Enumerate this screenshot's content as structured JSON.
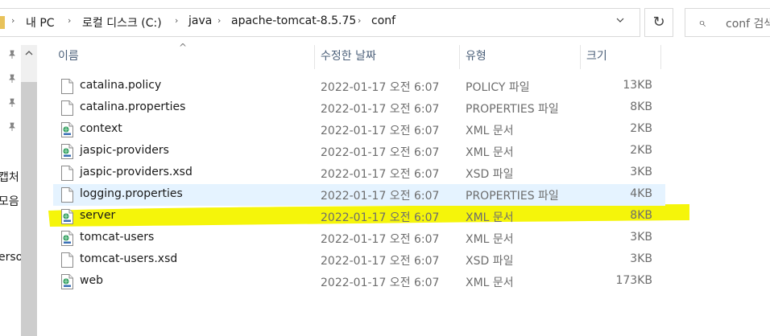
{
  "address_bar": {
    "breadcrumbs": [
      "내 PC",
      "로컬 디스크 (C:)",
      "java",
      "apache-tomcat-8.5.75",
      "conf"
    ],
    "separator": "›",
    "dropdown_icon": "chevron-down-icon",
    "refresh_icon": "refresh-icon",
    "refresh_glyph": "↻"
  },
  "search": {
    "placeholder": "conf 검색",
    "icon": "search-icon",
    "glyph": "⌕"
  },
  "nav_pane": {
    "pin_icons": 4,
    "labels": [
      "캡처",
      "모음",
      "erso"
    ]
  },
  "columns": {
    "name": "이름",
    "date": "수정한 날짜",
    "type": "유형",
    "size": "크기",
    "sort_glyph": "^"
  },
  "files": [
    {
      "name": "catalina.policy",
      "date": "2022-01-17 오전 6:07",
      "type": "POLICY 파일",
      "size": "13KB",
      "icon": "generic-file-icon"
    },
    {
      "name": "catalina.properties",
      "date": "2022-01-17 오전 6:07",
      "type": "PROPERTIES 파일",
      "size": "8KB",
      "icon": "generic-file-icon"
    },
    {
      "name": "context",
      "date": "2022-01-17 오전 6:07",
      "type": "XML 문서",
      "size": "2KB",
      "icon": "xml-file-icon"
    },
    {
      "name": "jaspic-providers",
      "date": "2022-01-17 오전 6:07",
      "type": "XML 문서",
      "size": "2KB",
      "icon": "xml-file-icon"
    },
    {
      "name": "jaspic-providers.xsd",
      "date": "2022-01-17 오전 6:07",
      "type": "XSD 파일",
      "size": "3KB",
      "icon": "generic-file-icon"
    },
    {
      "name": "logging.properties",
      "date": "2022-01-17 오전 6:07",
      "type": "PROPERTIES 파일",
      "size": "4KB",
      "icon": "generic-file-icon",
      "selected": true
    },
    {
      "name": "server",
      "date": "2022-01-17 오전 6:07",
      "type": "XML 문서",
      "size": "8KB",
      "icon": "xml-file-icon",
      "highlighted": true
    },
    {
      "name": "tomcat-users",
      "date": "2022-01-17 오전 6:07",
      "type": "XML 문서",
      "size": "3KB",
      "icon": "xml-file-icon"
    },
    {
      "name": "tomcat-users.xsd",
      "date": "2022-01-17 오전 6:07",
      "type": "XSD 파일",
      "size": "3KB",
      "icon": "generic-file-icon"
    },
    {
      "name": "web",
      "date": "2022-01-17 오전 6:07",
      "type": "XML 문서",
      "size": "173KB",
      "icon": "xml-file-icon"
    }
  ],
  "colors": {
    "selection": "#e5f3ff",
    "highlighter": "#f5f50a",
    "header_text": "#4c607a",
    "muted_text": "#6d6d6d"
  }
}
